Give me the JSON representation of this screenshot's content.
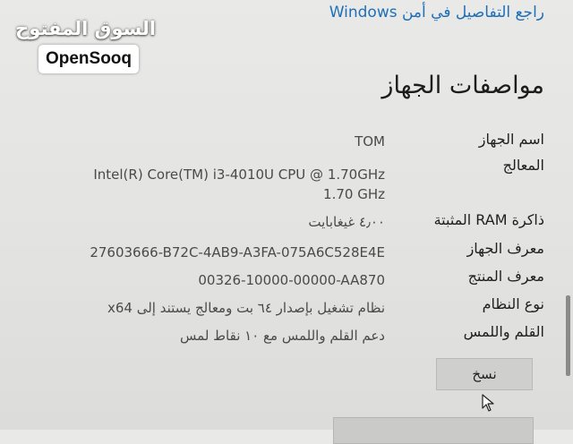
{
  "security_link": "راجع التفاصيل في أمن Windows",
  "section_title": "مواصفات الجهاز",
  "specs": [
    {
      "label": "اسم الجهاز",
      "value": "TOM"
    },
    {
      "label": "المعالج",
      "value": "Intel(R) Core(TM) i3-4010U CPU @ 1.70GHz",
      "value2": "1.70 GHz"
    },
    {
      "label": "ذاكرة RAM المثبتة",
      "value": "٤٫٠٠ غيغابايت"
    },
    {
      "label": "معرف الجهاز",
      "value": "27603666-B72C-4AB9-A3FA-075A6C528E4E"
    },
    {
      "label": "معرف المنتج",
      "value": "00326-10000-00000-AA870"
    },
    {
      "label": "نوع النظام",
      "value": "نظام تشغيل بإصدار ٦٤ بت ومعالج يستند إلى x64"
    },
    {
      "label": "القلم واللمس",
      "value": "دعم القلم واللمس مع ١٠ نقاط لمس"
    }
  ],
  "copy_button": "نسخ",
  "watermark": {
    "arabic": "السوق المفتوح",
    "brand": "OpenSooq"
  }
}
